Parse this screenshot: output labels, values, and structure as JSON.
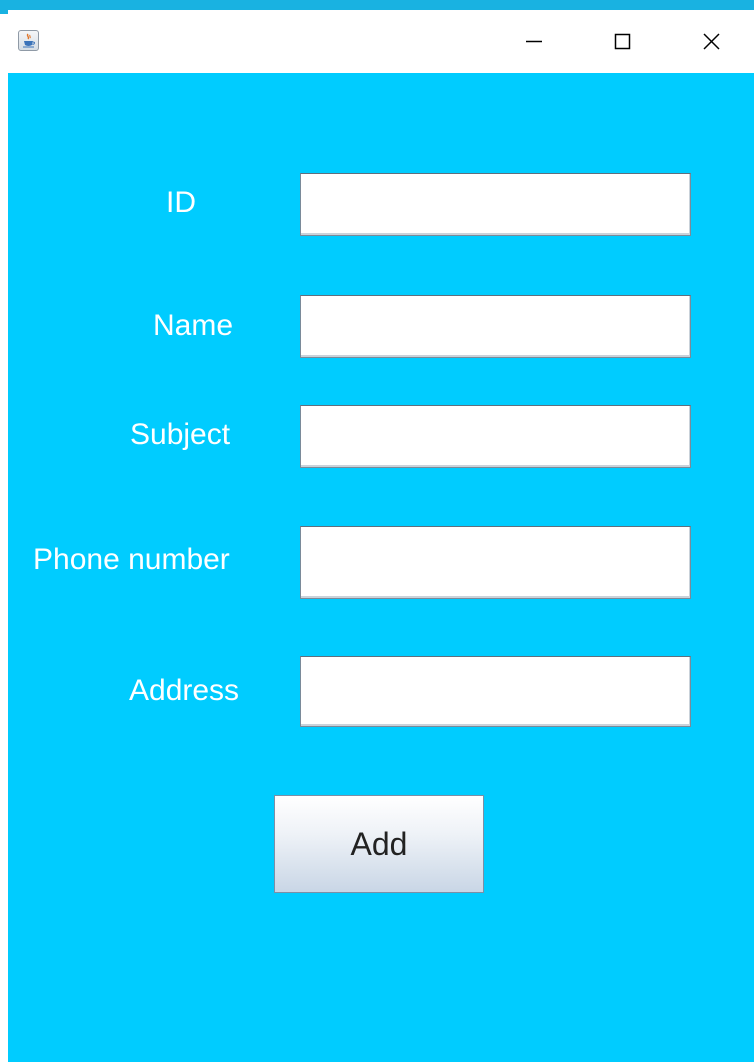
{
  "window": {
    "title": "",
    "app_icon": "java-cup-icon",
    "controls": {
      "minimize_icon": "minimize-icon",
      "maximize_icon": "maximize-icon",
      "close_icon": "close-icon"
    }
  },
  "form": {
    "fields": [
      {
        "label": "ID",
        "value": ""
      },
      {
        "label": "Name",
        "value": ""
      },
      {
        "label": "Subject",
        "value": ""
      },
      {
        "label": "Phone number",
        "value": ""
      },
      {
        "label": "Address",
        "value": ""
      }
    ],
    "submit_label": "Add"
  },
  "colors": {
    "background": "#00ccff",
    "label_text": "#ffffff",
    "titlebar": "#ffffff",
    "top_accent": "#19b2e1"
  }
}
